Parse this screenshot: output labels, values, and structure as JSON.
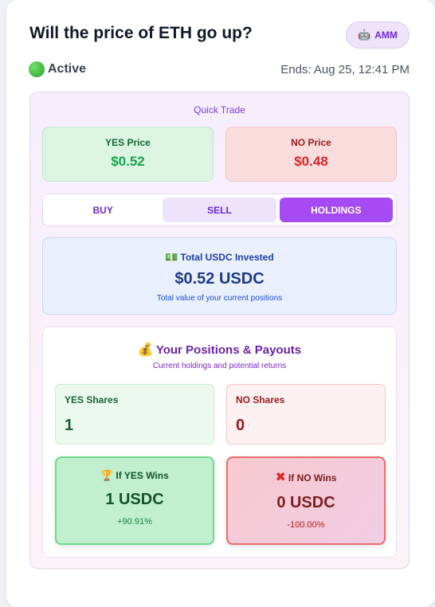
{
  "market": {
    "title": "Will the price of ETH go up?",
    "badge_icon": "robot-icon",
    "badge_label": "AMM",
    "status_label": "Active",
    "ends": "Ends: Aug 25, 12:41 PM"
  },
  "quick_trade": {
    "label": "Quick Trade",
    "yes_price_label": "YES Price",
    "yes_price": "$0.52",
    "no_price_label": "NO Price",
    "no_price": "$0.48"
  },
  "tabs": [
    {
      "label": "BUY",
      "active": false
    },
    {
      "label": "SELL",
      "active": false
    },
    {
      "label": "HOLDINGS",
      "active": true
    }
  ],
  "invested": {
    "icon": "money-icon",
    "title": "Total USDC Invested",
    "amount": "$0.52 USDC",
    "subtitle": "Total value of your current positions"
  },
  "positions": {
    "icon": "money-bag-icon",
    "title": "Your Positions & Payouts",
    "subtitle": "Current holdings and potential returns",
    "yes_shares_label": "YES Shares",
    "yes_shares": "1",
    "no_shares_label": "NO Shares",
    "no_shares": "0",
    "yes_win_label": "If YES Wins",
    "yes_win_value": "1 USDC",
    "yes_win_pct": "+90.91%",
    "no_win_label": "If NO Wins",
    "no_win_value": "0 USDC",
    "no_win_pct": "-100.00%"
  },
  "colors": {
    "accent": "#a64bf4",
    "yes": "#16a34a",
    "no": "#dc2626",
    "status": "#2c9a2a"
  }
}
